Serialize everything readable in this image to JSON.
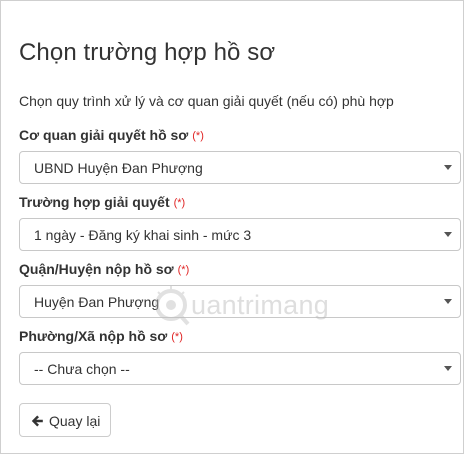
{
  "page": {
    "title": "Chọn trường hợp hồ sơ",
    "subtitle": "Chọn quy trình xử lý và cơ quan giải quyết (nếu có) phù hợp"
  },
  "form": {
    "required_mark": "(*)",
    "fields": [
      {
        "label": "Cơ quan giải quyết hồ sơ",
        "value": "UBND Huyện Đan Phượng"
      },
      {
        "label": "Trường hợp giải quyết",
        "value": "1 ngày - Đăng ký khai sinh - mức 3"
      },
      {
        "label": "Quận/Huyện nộp hồ sơ",
        "value": "Huyện Đan Phượng"
      },
      {
        "label": "Phường/Xã nộp hồ sơ",
        "value": "-- Chưa chọn --"
      }
    ]
  },
  "actions": {
    "back_label": "Quay lại"
  },
  "watermark": {
    "text": "uantrimang"
  },
  "colors": {
    "required": "#e02424",
    "text": "#333333",
    "border": "#c8c8c8"
  },
  "icons": {
    "back": "arrow-left-icon",
    "dropdown": "caret-down-icon",
    "watermark": "watermark-logo-icon"
  }
}
